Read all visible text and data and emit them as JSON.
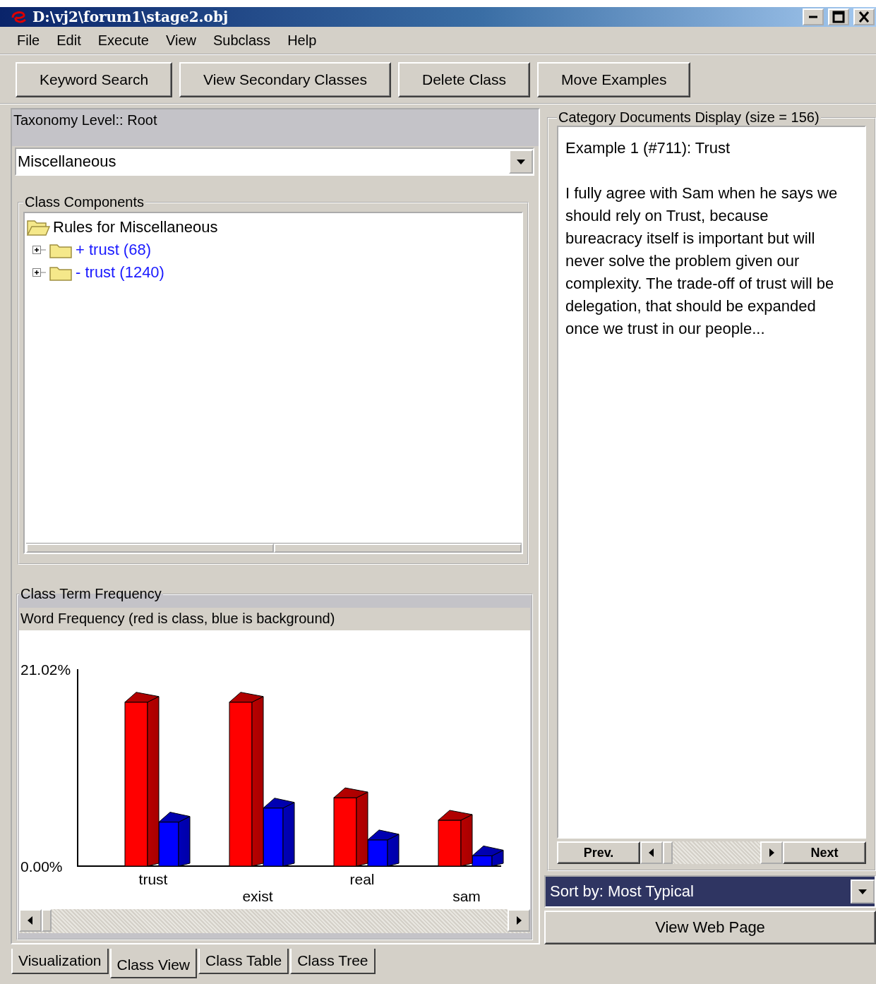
{
  "window": {
    "title": "D:\\vj2\\forum1\\stage2.obj"
  },
  "menu": [
    "File",
    "Edit",
    "Execute",
    "View",
    "Subclass",
    "Help"
  ],
  "toolbar": [
    "Keyword Search",
    "View Secondary Classes",
    "Delete Class",
    "Move Examples"
  ],
  "taxonomy": {
    "label": "Taxonomy Level:: Root",
    "class_select": "Miscellaneous"
  },
  "class_components": {
    "title": "Class Components",
    "tree": [
      {
        "label": "Rules for Miscellaneous",
        "expanded": true,
        "children": [
          {
            "label": "+ trust (68)",
            "expanded": false
          },
          {
            "label": "- trust (1240)",
            "expanded": false
          }
        ]
      }
    ]
  },
  "term_frequency": {
    "title": "Class Term Frequency",
    "chart_data": {
      "type": "bar",
      "title": "Word Frequency (red is class, blue is background)",
      "categories": [
        "trust",
        "exist",
        "real",
        "sam"
      ],
      "series": [
        {
          "color": "#ff0000",
          "values": [
            17.5,
            17.5,
            7.3,
            4.9
          ]
        },
        {
          "color": "#0000ff",
          "values": [
            4.7,
            6.2,
            2.8,
            1.1
          ]
        }
      ],
      "ylim": [
        0,
        21.02
      ],
      "yticks": [
        {
          "value": 0,
          "label": "0.00%"
        },
        {
          "value": 21.02,
          "label": "21.02%"
        }
      ]
    }
  },
  "documents": {
    "title": "Category Documents Display (size = 156)",
    "heading": "Example 1 (#711): Trust",
    "text": "I fully agree with Sam when he says we should rely on Trust, because bureacracy itself is important but will never solve the problem given our complexity. The trade-off of trust will be delegation, that should be expanded once we trust in our people...",
    "prev": "Prev.",
    "next": "Next",
    "sort": "Sort by: Most Typical",
    "view_button": "View Web Page"
  },
  "tabs": [
    {
      "label": "Visualization",
      "selected": false
    },
    {
      "label": "Class View",
      "selected": true
    },
    {
      "label": "Class Table",
      "selected": false
    },
    {
      "label": "Class Tree",
      "selected": false
    }
  ]
}
